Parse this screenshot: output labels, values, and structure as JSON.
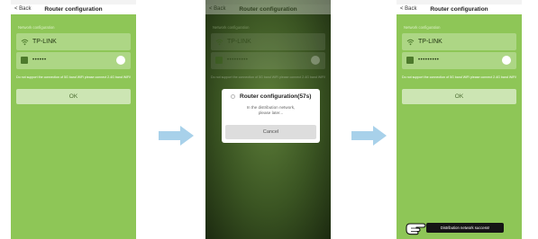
{
  "screen1": {
    "nav": {
      "back": "< Back",
      "title": "Router configuration"
    },
    "section_label": "Network configuration",
    "ssid_icon": "wifi-icon",
    "ssid": "TP-LINK",
    "password_icon": "lock-icon",
    "password": "••••••",
    "note": "Do not support the connection of 5G band WiFi please connect 2.4G band WiFi!",
    "ok_label": "OK"
  },
  "screen2": {
    "nav": {
      "back": "< Back",
      "title": "Router configuration"
    },
    "section_label": "Network configuration",
    "ssid": "TP-LINK",
    "password": "•••••••••",
    "note": "Do not support the connection of 5G band WiFi please connect 2.4G band WiFi!",
    "dialog": {
      "title": "Router configuration(57s)",
      "message_line1": "In the distribution network,",
      "message_line2": "please later...",
      "cancel_label": "Cancel"
    }
  },
  "screen3": {
    "nav": {
      "back": "< Back",
      "title": "Router configuration"
    },
    "section_label": "Network configuration",
    "ssid": "TP-LINK",
    "password": "•••••••••",
    "note": "Do not support the connection of 5G band WiFi please connect 2.4G band WiFi!",
    "ok_label": "OK"
  },
  "toast": "Distribution network success!",
  "colors": {
    "screen_green": "#8ec657",
    "arrow_blue": "#a8d1ea",
    "toast_bg": "#151515"
  }
}
